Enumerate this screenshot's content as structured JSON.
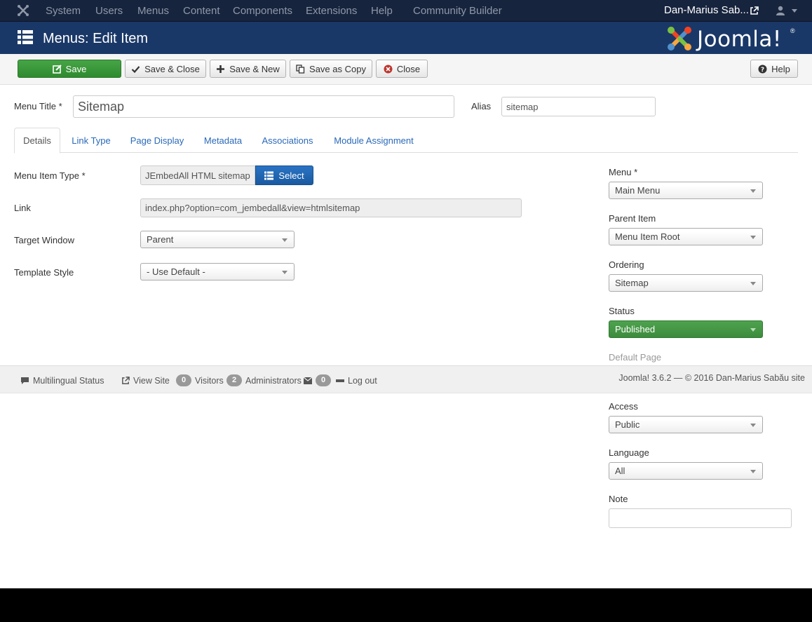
{
  "nav": {
    "items": [
      "System",
      "Users",
      "Menus",
      "Content",
      "Components",
      "Extensions",
      "Help",
      "Community Builder"
    ],
    "user": "Dan-Marius Sab..."
  },
  "header": {
    "title": "Menus: Edit Item",
    "brand": "Joomla!",
    "brand_mark": "®"
  },
  "toolbar": {
    "save": "Save",
    "save_close": "Save & Close",
    "save_new": "Save & New",
    "save_copy": "Save as Copy",
    "close": "Close",
    "help": "Help"
  },
  "form": {
    "menu_title_label": "Menu Title *",
    "menu_title_value": "Sitemap",
    "alias_label": "Alias",
    "alias_value": "sitemap",
    "tabs": [
      "Details",
      "Link Type",
      "Page Display",
      "Metadata",
      "Associations",
      "Module Assignment"
    ],
    "menu_item_type_label": "Menu Item Type *",
    "menu_item_type_value": "JEmbedAll HTML sitemap",
    "select_label": "Select",
    "link_label": "Link",
    "link_value": "index.php?option=com_jembedall&view=htmlsitemap",
    "target_window_label": "Target Window",
    "target_window_value": "Parent",
    "template_style_label": "Template Style",
    "template_style_value": "- Use Default -"
  },
  "sidebar": {
    "menu_label": "Menu *",
    "menu_value": "Main Menu",
    "parent_label": "Parent Item",
    "parent_value": "Menu Item Root",
    "ordering_label": "Ordering",
    "ordering_value": "Sitemap",
    "status_label": "Status",
    "status_value": "Published",
    "default_page_label": "Default Page",
    "access_label": "Access",
    "access_value": "Public",
    "language_label": "Language",
    "language_value": "All",
    "note_label": "Note",
    "note_value": ""
  },
  "statusbar": {
    "multilingual": "Multilingual Status",
    "view_site": "View Site",
    "visitors_count": "0",
    "visitors_label": "Visitors",
    "admins_count": "2",
    "admins_label": "Administrators",
    "messages_count": "0",
    "logout": "Log out",
    "copyright": "Joomla! 3.6.2 — © 2016 Dan-Marius Sabău site"
  },
  "colors": {
    "navbar": "#17243e",
    "header": "#1a3867",
    "save_green": "#46a546",
    "status_green": "#3d8b3d",
    "link_blue": "#2a69b8"
  }
}
